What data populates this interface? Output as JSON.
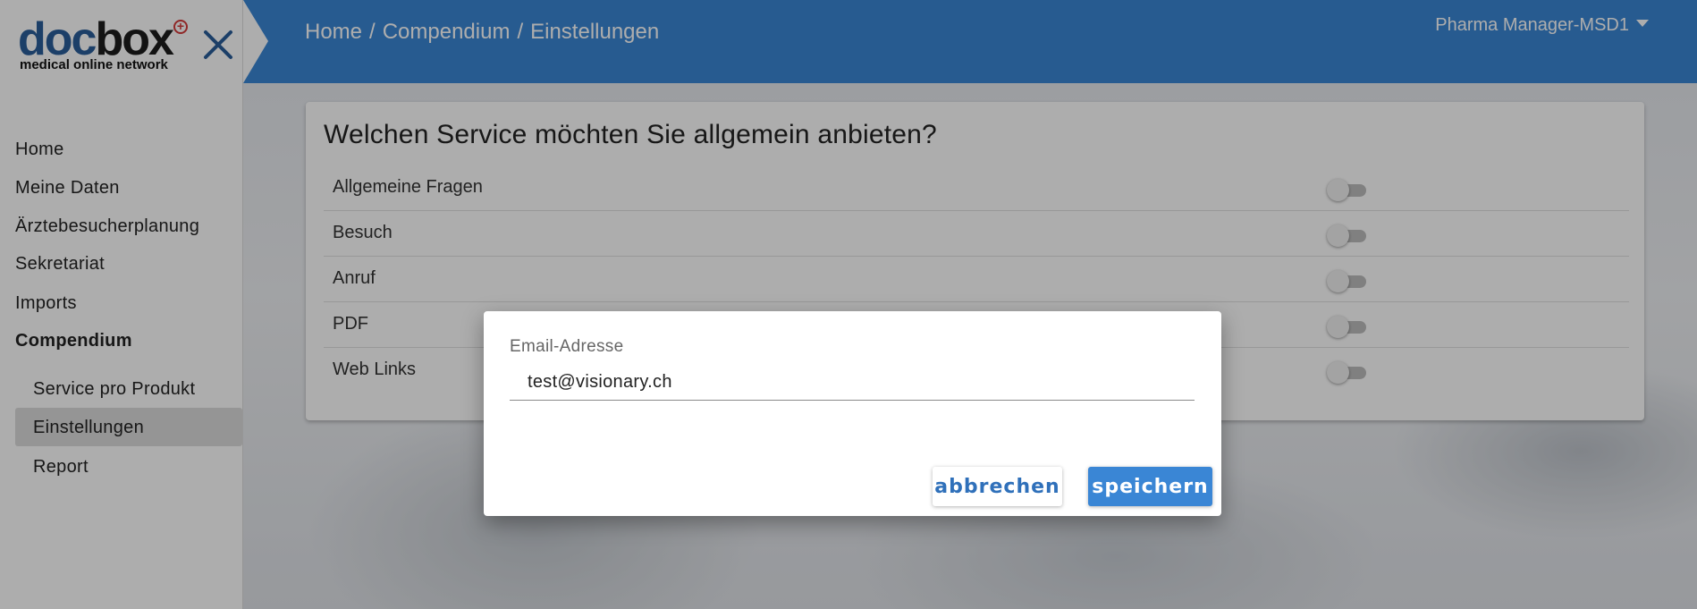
{
  "logo": {
    "word_doc": "doc",
    "word_box": "box",
    "plus": "+",
    "tagline": "medical online network"
  },
  "header": {
    "breadcrumbs": [
      "Home",
      "Compendium",
      "Einstellungen"
    ],
    "separator": "/",
    "user": "Pharma Manager-MSD1",
    "close_icon": "close-x-icon"
  },
  "sidebar": {
    "items": [
      {
        "label": "Home"
      },
      {
        "label": "Meine Daten"
      },
      {
        "label": "Ärztebesucherplanung"
      },
      {
        "label": "Sekretariat"
      },
      {
        "label": "Imports"
      },
      {
        "label": "Compendium"
      }
    ],
    "sub_items": [
      {
        "label": "Service pro Produkt"
      },
      {
        "label": "Einstellungen"
      },
      {
        "label": "Report"
      }
    ],
    "active_item": "Compendium",
    "active_sub_item": "Einstellungen"
  },
  "card": {
    "title": "Welchen Service möchten Sie allgemein anbieten?",
    "services": [
      {
        "label": "Allgemeine Fragen",
        "enabled": false
      },
      {
        "label": "Besuch",
        "enabled": false
      },
      {
        "label": "Anruf",
        "enabled": false
      },
      {
        "label": "PDF",
        "enabled": false
      },
      {
        "label": "Web Links",
        "enabled": false
      }
    ]
  },
  "dialog": {
    "field_label": "Email-Adresse",
    "field_value": "test@visionary.ch",
    "cancel_label": "abbrechen",
    "save_label": "speichern"
  },
  "colors": {
    "header_blue": "#3a86d5",
    "logo_blue": "#2a5e9a",
    "plus_red": "#d43a3a",
    "cancel_text": "#2f70ba"
  }
}
